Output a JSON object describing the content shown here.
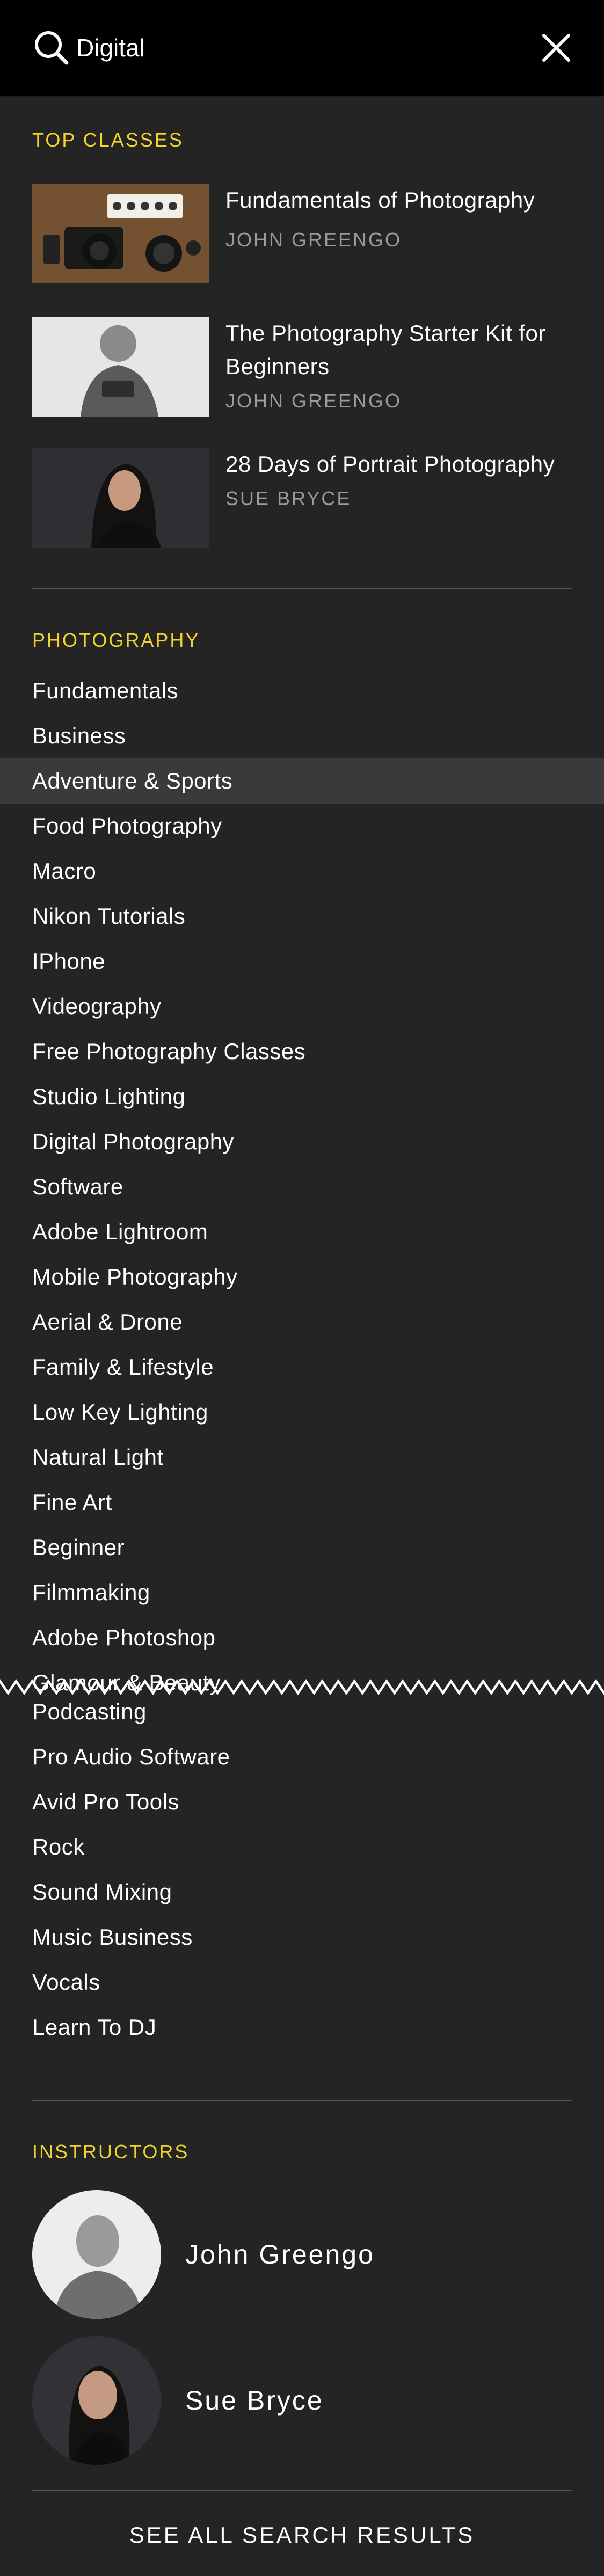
{
  "search": {
    "value": "Digital"
  },
  "top_classes": {
    "heading": "TOP CLASSES",
    "items": [
      {
        "title": "Fundamentals of Photography",
        "author": "JOHN GREENGO"
      },
      {
        "title": "The Photography Starter Kit for Beginners",
        "author": "JOHN GREENGO"
      },
      {
        "title": "28 Days of Portrait Photography",
        "author": "SUE BRYCE"
      }
    ]
  },
  "photography": {
    "heading": "PHOTOGRAPHY",
    "items": [
      "Fundamentals",
      "Business",
      "Adventure & Sports",
      "Food Photography",
      "Macro",
      "Nikon Tutorials",
      "IPhone",
      "Videography",
      "Free Photography Classes",
      "Studio Lighting",
      "Digital Photography",
      "Software",
      "Adobe Lightroom",
      "Mobile Photography",
      "Aerial & Drone",
      "Family & Lifestyle",
      "Low Key Lighting",
      "Natural Light",
      "Fine Art",
      "Beginner",
      "Filmmaking",
      "Adobe Photoshop",
      "Glamour & Beauty"
    ],
    "highlighted_item": "Adventure & Sports"
  },
  "audio": {
    "items": [
      "Podcasting",
      "Pro Audio Software",
      "Avid Pro Tools",
      "Rock",
      "Sound Mixing",
      "Music Business",
      "Vocals",
      "Learn To DJ"
    ]
  },
  "instructors": {
    "heading": "INSTRUCTORS",
    "items": [
      {
        "name": "John Greengo"
      },
      {
        "name": "Sue Bryce"
      }
    ]
  },
  "footer": {
    "see_all_label": "SEE ALL SEARCH RESULTS"
  },
  "colors": {
    "accent": "#f1d32c",
    "background": "#242424",
    "header": "#000000",
    "muted": "#9b9b9b"
  },
  "icons": {
    "search": "search-icon",
    "close": "close-icon"
  }
}
